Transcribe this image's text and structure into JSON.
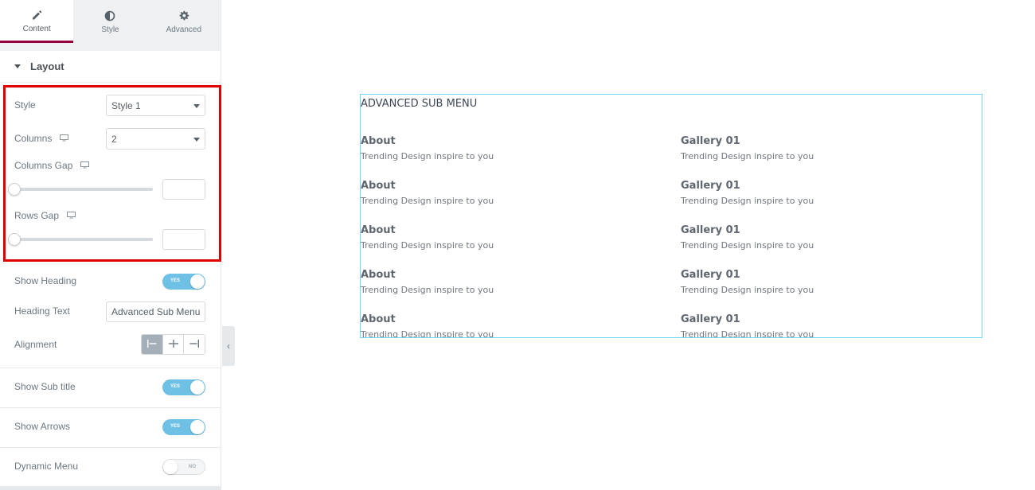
{
  "tabs": [
    {
      "label": "Content",
      "icon": "pencil-icon",
      "active": true
    },
    {
      "label": "Style",
      "icon": "half-circle-icon",
      "active": false
    },
    {
      "label": "Advanced",
      "icon": "gear-icon",
      "active": false
    }
  ],
  "section": {
    "title": "Layout"
  },
  "controls": {
    "style": {
      "label": "Style",
      "value": "Style 1"
    },
    "columns": {
      "label": "Columns",
      "value": "2"
    },
    "columns_gap": {
      "label": "Columns Gap",
      "value": 0
    },
    "rows_gap": {
      "label": "Rows Gap",
      "value": 0
    },
    "show_heading": {
      "label": "Show Heading",
      "state": "YES"
    },
    "heading_text": {
      "label": "Heading Text",
      "value": "Advanced Sub Menu"
    },
    "alignment": {
      "label": "Alignment",
      "options": [
        "left",
        "center",
        "right"
      ],
      "selected": "left"
    },
    "show_subtitle": {
      "label": "Show Sub title",
      "state": "YES"
    },
    "show_arrows": {
      "label": "Show Arrows",
      "state": "YES"
    },
    "dynamic_menu": {
      "label": "Dynamic Menu",
      "state": "NO"
    }
  },
  "preview": {
    "heading": "ADVANCED SUB MENU",
    "items": [
      {
        "title": "About",
        "subtitle": "Trending Design inspire to you"
      },
      {
        "title": "Gallery 01",
        "subtitle": "Trending Design inspire to you"
      },
      {
        "title": "About",
        "subtitle": "Trending Design inspire to you"
      },
      {
        "title": "Gallery 01",
        "subtitle": "Trending Design inspire to you"
      },
      {
        "title": "About",
        "subtitle": "Trending Design inspire to you"
      },
      {
        "title": "Gallery 01",
        "subtitle": "Trending Design inspire to you"
      },
      {
        "title": "About",
        "subtitle": "Trending Design inspire to you"
      },
      {
        "title": "Gallery 01",
        "subtitle": "Trending Design inspire to you"
      },
      {
        "title": "About",
        "subtitle": "Trending Design inspire to you"
      },
      {
        "title": "Gallery 01",
        "subtitle": "Trending Design inspire to you"
      }
    ]
  },
  "colors": {
    "accent_tab": "#93003c",
    "toggle_on": "#6ec1e4",
    "highlight_box": "#e00000",
    "preview_border": "#71d7f7"
  }
}
